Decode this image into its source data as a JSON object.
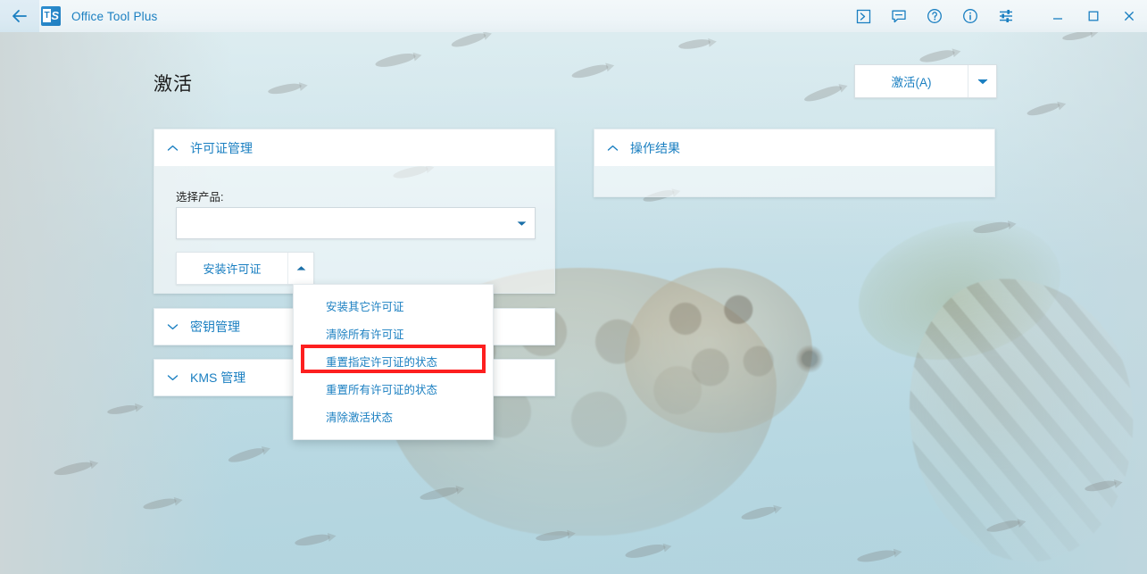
{
  "window": {
    "app_title": "Office Tool Plus",
    "back_icon": "back-arrow-icon",
    "logo_letter": "T",
    "logo_mark": "◢",
    "controls": [
      {
        "name": "console-icon",
        "label": "❯"
      },
      {
        "name": "feedback-icon",
        "label": "ὊC"
      },
      {
        "name": "help-icon",
        "label": "?"
      },
      {
        "name": "info-icon",
        "label": "i"
      },
      {
        "name": "settings-sliders-icon",
        "label": "≡"
      },
      {
        "name": "minimize-icon",
        "label": "—"
      },
      {
        "name": "maximize-icon",
        "label": "□"
      },
      {
        "name": "close-icon",
        "label": "✕"
      }
    ]
  },
  "page": {
    "title": "激活"
  },
  "activate_button": {
    "label": "激活(A)",
    "dropdown_icon": "chevron-down-icon"
  },
  "panels": {
    "license": {
      "title": "许可证管理",
      "chevron": "chevron-up-icon",
      "expanded": true,
      "product_label": "选择产品:",
      "product_value": "",
      "product_placeholder": "",
      "install_button": "安装许可证",
      "install_dropdown_icon": "chevron-up-icon"
    },
    "key": {
      "title": "密钥管理",
      "chevron": "chevron-down-icon",
      "expanded": false
    },
    "kms": {
      "title": "KMS 管理",
      "chevron": "chevron-down-icon",
      "expanded": false
    },
    "result": {
      "title": "操作结果",
      "chevron": "chevron-up-icon",
      "expanded": true,
      "body_text": ""
    }
  },
  "install_menu": {
    "open": true,
    "items": [
      {
        "label": "安装其它许可证",
        "highlighted": false
      },
      {
        "label": "清除所有许可证",
        "highlighted": true
      },
      {
        "label": "重置指定许可证的状态",
        "highlighted": false
      },
      {
        "label": "重置所有许可证的状态",
        "highlighted": false
      },
      {
        "label": "清除激活状态",
        "highlighted": false
      }
    ]
  },
  "colors": {
    "accent_blue": "#1a7fc1",
    "highlight_red": "#fd1f1f",
    "titlebar_bg": "#eef5f8",
    "panel_white": "#ffffff",
    "water_blue": "#c4dee6"
  }
}
